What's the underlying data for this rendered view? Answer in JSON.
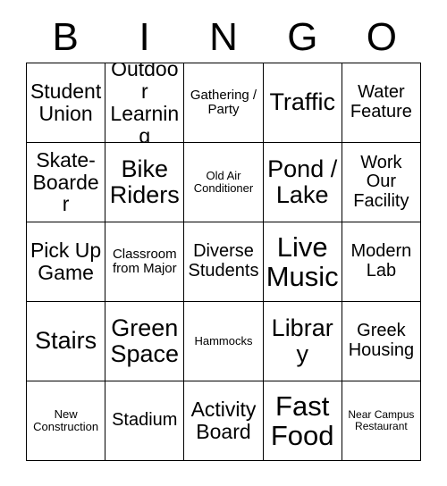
{
  "card": {
    "header_letters": [
      "B",
      "I",
      "N",
      "G",
      "O"
    ],
    "columns": {
      "B": [
        {
          "text": "Student Union",
          "size": "lg"
        },
        {
          "text": "Skate-Boarder",
          "size": "lg"
        },
        {
          "text": "Pick Up Game",
          "size": "lg"
        },
        {
          "text": "Stairs",
          "size": "xl"
        },
        {
          "text": "New Construction",
          "size": "xs"
        }
      ],
      "I": [
        {
          "text": "Outdoor Learning",
          "size": "lg"
        },
        {
          "text": "Bike Riders",
          "size": "xl"
        },
        {
          "text": "Classroom from Major",
          "size": "sm"
        },
        {
          "text": "Green Space",
          "size": "xl"
        },
        {
          "text": "Stadium",
          "size": "md"
        }
      ],
      "N": [
        {
          "text": "Gathering / Party",
          "size": "sm"
        },
        {
          "text": "Old Air Conditioner",
          "size": "xs"
        },
        {
          "text": "Diverse Students",
          "size": "md"
        },
        {
          "text": "Hammocks",
          "size": "xs"
        },
        {
          "text": "Activity Board",
          "size": "lg"
        }
      ],
      "G": [
        {
          "text": "Traffic",
          "size": "xl"
        },
        {
          "text": "Pond / Lake",
          "size": "xl"
        },
        {
          "text": "Live Music",
          "size": "xxl"
        },
        {
          "text": "Library",
          "size": "xl"
        },
        {
          "text": "Fast Food",
          "size": "xxl"
        }
      ],
      "O": [
        {
          "text": "Water Feature",
          "size": "md"
        },
        {
          "text": "Work Our Facility",
          "size": "md"
        },
        {
          "text": "Modern Lab",
          "size": "md"
        },
        {
          "text": "Greek Housing",
          "size": "md"
        },
        {
          "text": "Near Campus Restaurant",
          "size": "xxs"
        }
      ]
    },
    "cells_in_reading_order": [
      "Student Union",
      "Outdoor Learning",
      "Gathering / Party",
      "Traffic",
      "Water Feature",
      "Skate-Boarder",
      "Bike Riders",
      "Old Air Conditioner",
      "Pond / Lake",
      "Work Our Facility",
      "Pick Up Game",
      "Classroom from Major",
      "Diverse Students",
      "Live Music",
      "Modern Lab",
      "Stairs",
      "Green Space",
      "Hammocks",
      "Library",
      "Greek Housing",
      "New Construction",
      "Stadium",
      "Activity Board",
      "Fast Food",
      "Near Campus Restaurant"
    ],
    "colors": {
      "background": "#ffffff",
      "text": "#000000",
      "grid_line": "#000000"
    },
    "grid_size": "5x5"
  }
}
